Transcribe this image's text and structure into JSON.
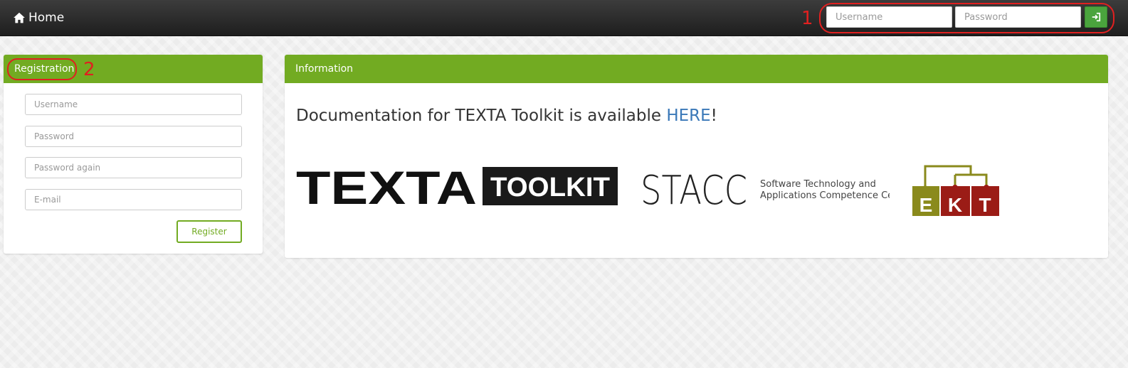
{
  "navbar": {
    "home_label": "Home",
    "username_placeholder": "Username",
    "password_placeholder": "Password",
    "annotation_1": "1"
  },
  "registration": {
    "heading": "Registration",
    "annotation_2": "2",
    "username_placeholder": "Username",
    "password_placeholder": "Password",
    "password_again_placeholder": "Password again",
    "email_placeholder": "E-mail",
    "register_label": "Register"
  },
  "information": {
    "heading": "Information",
    "doc_prefix": "Documentation for TEXTA Toolkit is available ",
    "doc_link": "HERE",
    "doc_suffix": "!",
    "logos": {
      "texta_text": "TEXTA",
      "toolkit_text": "TOOLKIT",
      "stacc_text": "STACC",
      "stacc_tagline_1": "Software Technology and",
      "stacc_tagline_2": "Applications Competence Center",
      "ekt_letters": [
        "E",
        "K",
        "T"
      ]
    }
  },
  "colors": {
    "accent_green": "#72ab22",
    "button_green": "#4aa43d",
    "annotation_red": "#e02020",
    "link_blue": "#3a78b8",
    "ekt_olive": "#8a8a1c",
    "ekt_red": "#9b1c16"
  }
}
